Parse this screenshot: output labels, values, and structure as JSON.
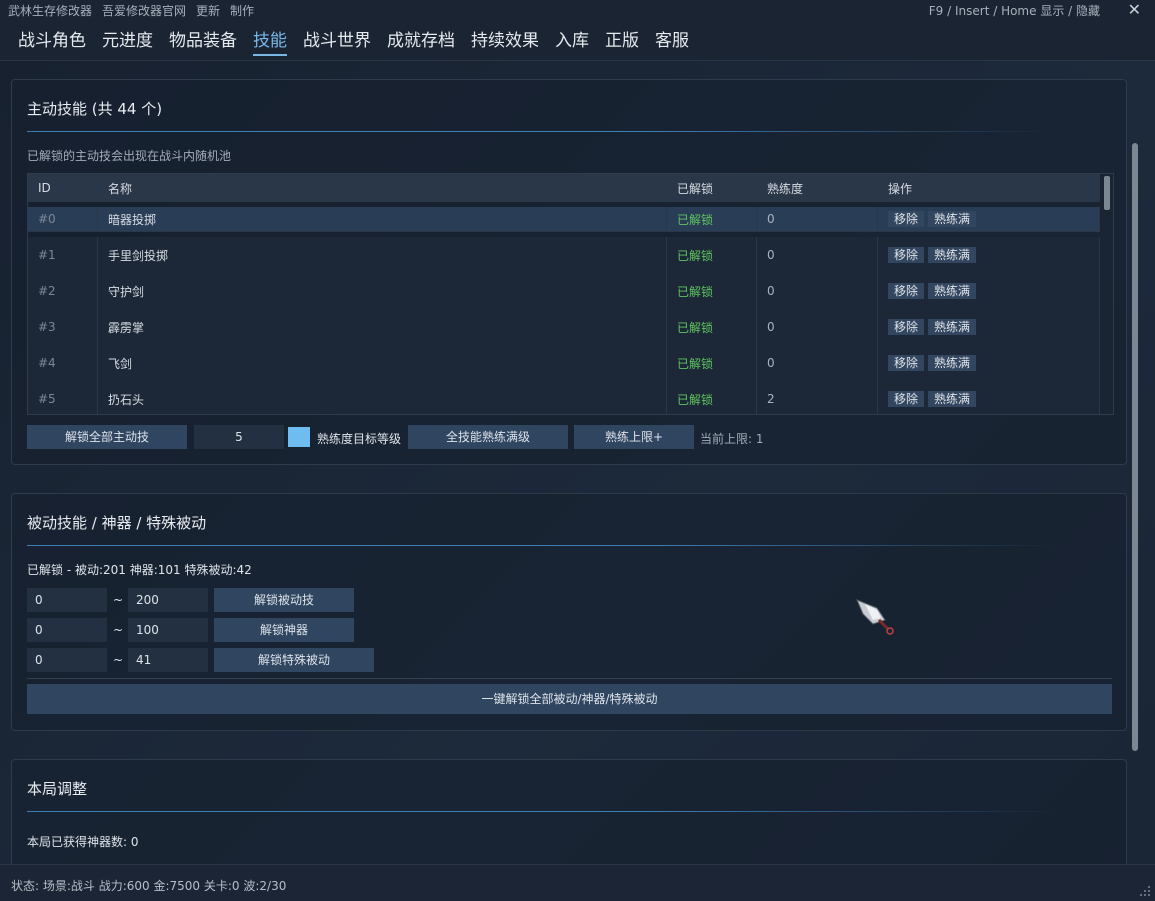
{
  "topbar": {
    "menu": [
      "武林生存修改器",
      "吾爱修改器官网",
      "更新",
      "制作"
    ],
    "hotkey": "F9 / Insert / Home  显示 / 隐藏",
    "close": "✕"
  },
  "tabs": [
    "战斗角色",
    "元进度",
    "物品装备",
    "技能",
    "战斗世界",
    "成就存档",
    "持续效果",
    "入库",
    "正版",
    "客服"
  ],
  "active_tab": "技能",
  "active_skills": {
    "title": "主动技能 (共 44 个)",
    "desc": "已解锁的主动技会出现在战斗内随机池",
    "headers": [
      "ID",
      "名称",
      "已解锁",
      "熟练度",
      "操作"
    ],
    "rows": [
      {
        "id": "#0",
        "name": "暗器投掷",
        "unlocked": "已解锁",
        "prof": "0"
      },
      {
        "id": "#1",
        "name": "手里剑投掷",
        "unlocked": "已解锁",
        "prof": "0"
      },
      {
        "id": "#2",
        "name": "守护剑",
        "unlocked": "已解锁",
        "prof": "0"
      },
      {
        "id": "#3",
        "name": "霹雳掌",
        "unlocked": "已解锁",
        "prof": "0"
      },
      {
        "id": "#4",
        "name": "飞剑",
        "unlocked": "已解锁",
        "prof": "0"
      },
      {
        "id": "#5",
        "name": "扔石头",
        "unlocked": "已解锁",
        "prof": "2"
      }
    ],
    "row_actions": [
      "移除",
      "熟练满"
    ],
    "unlock_all": "解锁全部主动技",
    "target_level": "5",
    "target_label": "熟练度目标等级",
    "max_all": "全技能熟练满级",
    "limit_plus": "熟练上限+",
    "current_limit": "当前上限: 1"
  },
  "passive": {
    "title": "被动技能 / 神器 / 特殊被动",
    "summary": "已解锁 - 被动:201  神器:101  特殊被动:42",
    "ranges": [
      {
        "from": "0",
        "to": "200",
        "button": "解锁被动技"
      },
      {
        "from": "0",
        "to": "100",
        "button": "解锁神器"
      },
      {
        "from": "0",
        "to": "41",
        "button": "解锁特殊被动"
      }
    ],
    "tilde": "~",
    "unlock_all": "一键解锁全部被动/神器/特殊被动"
  },
  "round": {
    "title": "本局调整",
    "artifacts": "本局已获得神器数: 0"
  },
  "status": "状态: 场景:战斗  战力:600  金:7500  关卡:0  波:2/30",
  "colors": {
    "accent": "#79b8e6",
    "unlocked": "#5ec45e",
    "checkbox": "#6fbdf0"
  }
}
